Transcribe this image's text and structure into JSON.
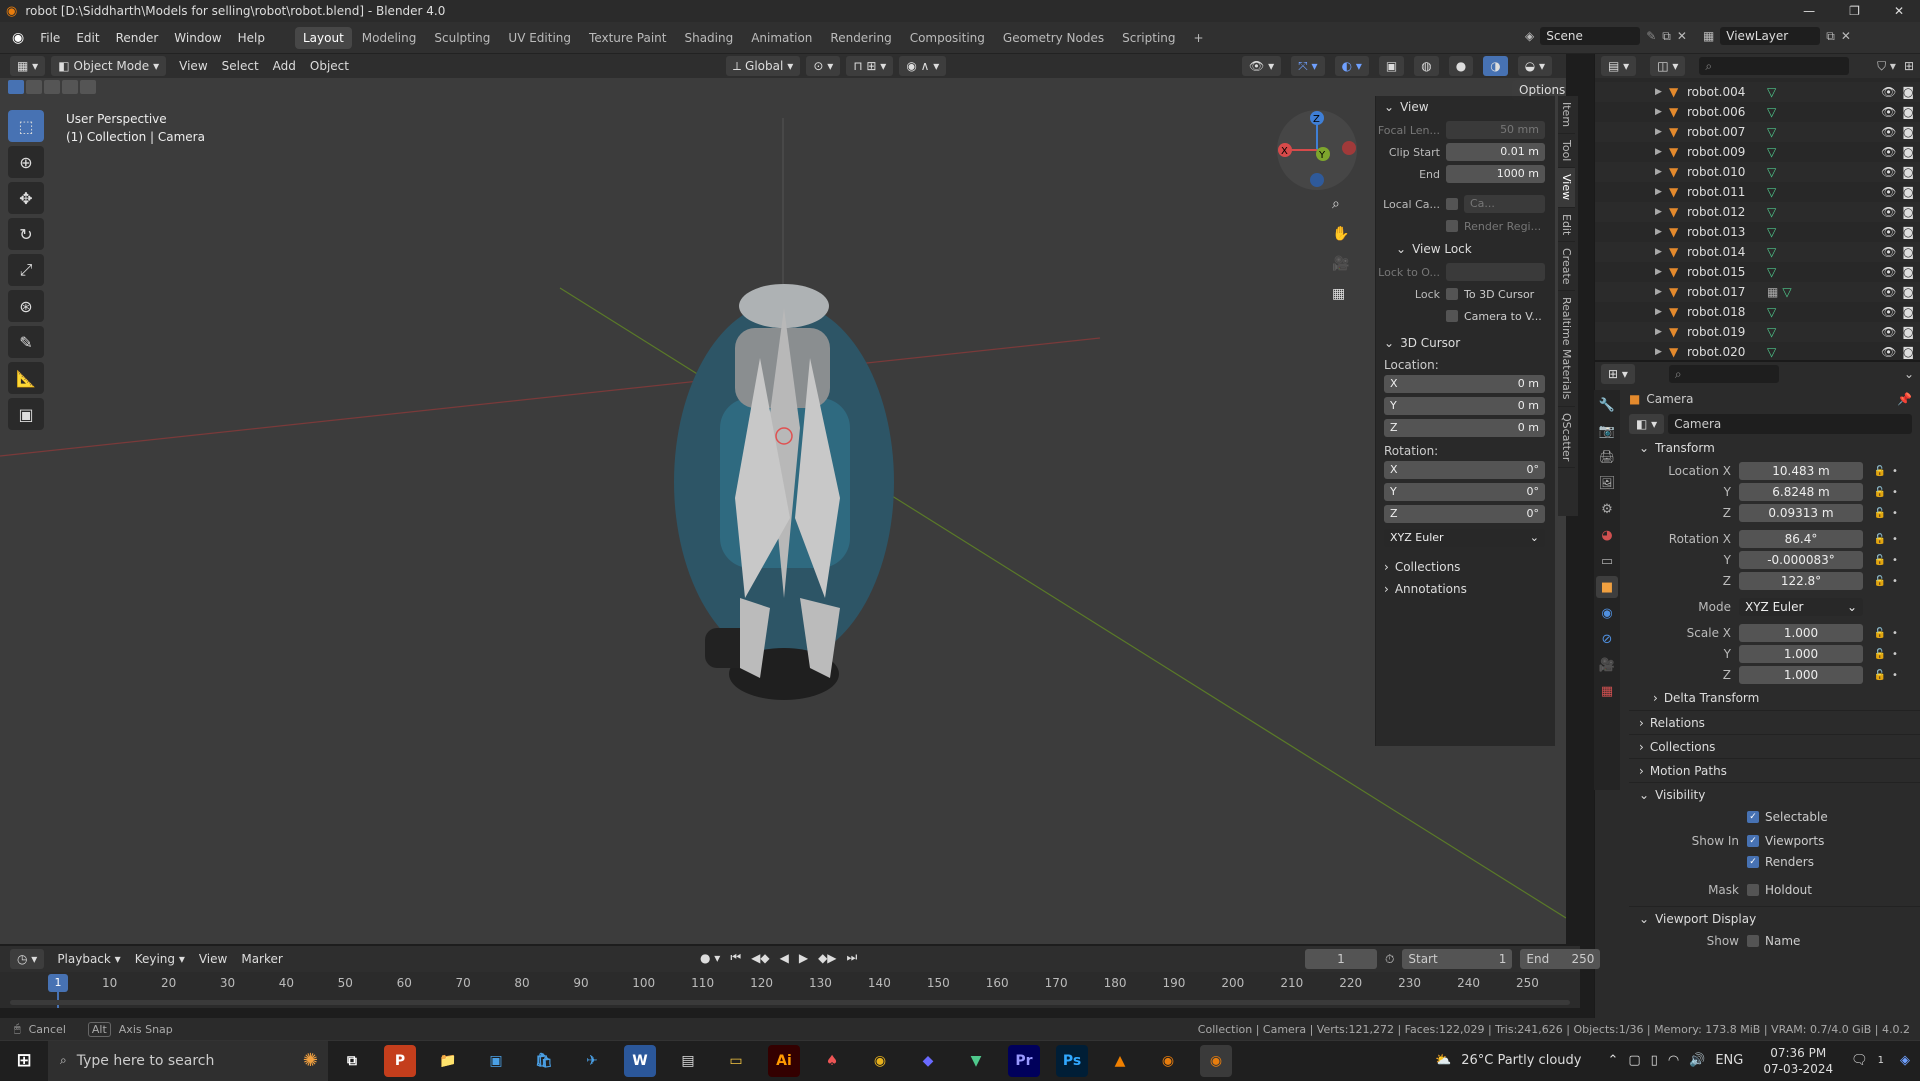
{
  "window": {
    "title": "robot [D:\\Siddharth\\Models for selling\\robot\\robot.blend] - Blender 4.0"
  },
  "menu": {
    "items": [
      "File",
      "Edit",
      "Render",
      "Window",
      "Help"
    ]
  },
  "workspaces": [
    "Layout",
    "Modeling",
    "Sculpting",
    "UV Editing",
    "Texture Paint",
    "Shading",
    "Animation",
    "Rendering",
    "Compositing",
    "Geometry Nodes",
    "Scripting"
  ],
  "scene": {
    "scene_label": "Scene",
    "view_layer": "ViewLayer"
  },
  "viewport_header": {
    "mode": "Object Mode",
    "view": "View",
    "select": "Select",
    "add": "Add",
    "object": "Object",
    "orientation": "Global",
    "options": "Options"
  },
  "viewport": {
    "perspective": "User Perspective",
    "collection_info": "(1) Collection | Camera"
  },
  "npanel": {
    "view_header": "View",
    "focal_label": "Focal Len...",
    "focal_value": "50 mm",
    "clip_start_label": "Clip Start",
    "clip_start_value": "0.01 m",
    "end_label": "End",
    "end_value": "1000 m",
    "local_cam_label": "Local Ca...",
    "local_cam_value": "Ca...",
    "render_region": "Render Regi...",
    "view_lock_header": "View Lock",
    "lock_to_label": "Lock to O...",
    "lock_label": "Lock",
    "to_cursor": "To 3D Cursor",
    "camera_to_view": "Camera to V...",
    "cursor_header": "3D Cursor",
    "location_label": "Location:",
    "loc_x": "0 m",
    "loc_y": "0 m",
    "loc_z": "0 m",
    "rotation_label": "Rotation:",
    "rot_x": "0°",
    "rot_y": "0°",
    "rot_z": "0°",
    "rotation_mode": "XYZ Euler",
    "collections": "Collections",
    "annotations": "Annotations",
    "axis_x": "X",
    "axis_y": "Y",
    "axis_z": "Z"
  },
  "side_tabs": [
    "Item",
    "Tool",
    "View",
    "Edit",
    "Create",
    "Realtime Materials",
    "QScatter"
  ],
  "outliner": {
    "items": [
      "robot.004",
      "robot.006",
      "robot.007",
      "robot.009",
      "robot.010",
      "robot.011",
      "robot.012",
      "robot.013",
      "robot.014",
      "robot.015",
      "robot.017",
      "robot.018",
      "robot.019",
      "robot.020"
    ]
  },
  "properties": {
    "object_name": "Camera",
    "object_field": "Camera",
    "transform_header": "Transform",
    "location_x_label": "Location X",
    "location_x": "10.483 m",
    "y_label": "Y",
    "location_y": "6.8248 m",
    "z_label": "Z",
    "location_z": "0.09313 m",
    "rotation_x_label": "Rotation X",
    "rotation_x": "86.4°",
    "rotation_y": "-0.000083°",
    "rotation_z": "122.8°",
    "mode_label": "Mode",
    "mode_value": "XYZ Euler",
    "scale_x_label": "Scale X",
    "scale_x": "1.000",
    "scale_y": "1.000",
    "scale_z": "1.000",
    "delta_transform": "Delta Transform",
    "relations": "Relations",
    "collections": "Collections",
    "motion_paths": "Motion Paths",
    "visibility": "Visibility",
    "selectable": "Selectable",
    "show_in_label": "Show In",
    "viewports": "Viewports",
    "renders": "Renders",
    "mask_label": "Mask",
    "holdout": "Holdout",
    "viewport_display": "Viewport Display",
    "show_label": "Show",
    "name": "Name"
  },
  "timeline": {
    "playback": "Playback",
    "keying": "Keying",
    "view": "View",
    "marker": "Marker",
    "current_frame": "1",
    "start_label": "Start",
    "start_value": "1",
    "end_label": "End",
    "end_value": "250",
    "ruler": [
      "1",
      "10",
      "20",
      "30",
      "40",
      "50",
      "60",
      "70",
      "80",
      "90",
      "100",
      "110",
      "120",
      "130",
      "140",
      "150",
      "160",
      "170",
      "180",
      "190",
      "200",
      "210",
      "220",
      "230",
      "240",
      "250"
    ]
  },
  "statusbar": {
    "cancel": "Cancel",
    "alt_key": "Alt",
    "axis_snap": "Axis Snap",
    "stats": "Collection | Camera | Verts:121,272 | Faces:122,029 | Tris:241,626 | Objects:1/36 | Memory: 173.8 MiB | VRAM: 0.7/4.0 GiB | 4.0.2"
  },
  "taskbar": {
    "search_placeholder": "Type here to search",
    "weather": "26°C  Partly cloudy",
    "lang": "ENG",
    "time": "07:36 PM",
    "date": "07-03-2024",
    "notifications": "1"
  },
  "colors": {
    "accent": "#4772b3",
    "axis_x": "#d64a4a",
    "axis_y": "#7ea62d",
    "axis_z": "#3f7fd6",
    "object_orange": "#e48a2d"
  }
}
